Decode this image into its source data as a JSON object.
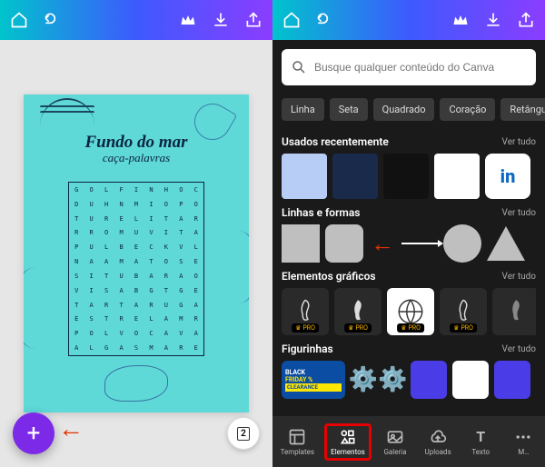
{
  "left": {
    "canvas": {
      "title_line1": "Fundo do mar",
      "title_line2": "caça-palavras",
      "grid": [
        [
          "G",
          "O",
          "L",
          "F",
          "I",
          "N",
          "H",
          "O",
          "C"
        ],
        [
          "D",
          "U",
          "H",
          "N",
          "M",
          "I",
          "O",
          "P",
          "O"
        ],
        [
          "T",
          "U",
          "R",
          "E",
          "L",
          "I",
          "T",
          "A",
          "R"
        ],
        [
          "R",
          "R",
          "O",
          "M",
          "U",
          "V",
          "I",
          "T",
          "A"
        ],
        [
          "P",
          "U",
          "L",
          "B",
          "E",
          "C",
          "K",
          "V",
          "L"
        ],
        [
          "N",
          "A",
          "A",
          "M",
          "A",
          "T",
          "O",
          "S",
          "E"
        ],
        [
          "S",
          "I",
          "T",
          "U",
          "B",
          "A",
          "R",
          "A",
          "O"
        ],
        [
          "V",
          "I",
          "S",
          "A",
          "B",
          "G",
          "T",
          "G",
          "E"
        ],
        [
          "T",
          "A",
          "R",
          "T",
          "A",
          "R",
          "U",
          "G",
          "A"
        ],
        [
          "E",
          "S",
          "T",
          "R",
          "E",
          "L",
          "A",
          "M",
          "R"
        ],
        [
          "P",
          "O",
          "L",
          "V",
          "O",
          "C",
          "A",
          "V",
          "A"
        ],
        [
          "A",
          "L",
          "G",
          "A",
          "S",
          "M",
          "A",
          "R",
          "E"
        ]
      ]
    },
    "page_count": "2"
  },
  "right": {
    "search_placeholder": "Busque qualquer conteúdo do Canva",
    "chips": [
      "Linha",
      "Seta",
      "Quadrado",
      "Coração",
      "Retângulo"
    ],
    "sections": {
      "recent": {
        "title": "Usados recentemente",
        "more": "Ver tudo"
      },
      "shapes": {
        "title": "Linhas e formas",
        "more": "Ver tudo"
      },
      "graphics": {
        "title": "Elementos gráficos",
        "more": "Ver tudo"
      },
      "stickers": {
        "title": "Figurinhas",
        "more": "Ver tudo"
      }
    },
    "pro_label": "PRO",
    "sticker_bf": {
      "l1": "BLACK",
      "l2": "FRIDAY %",
      "l3": "CLEARANCE"
    },
    "nav": {
      "templates": "Templates",
      "elementos": "Elementos",
      "galeria": "Galeria",
      "uploads": "Uploads",
      "texto": "Texto",
      "mais": "M…"
    }
  }
}
